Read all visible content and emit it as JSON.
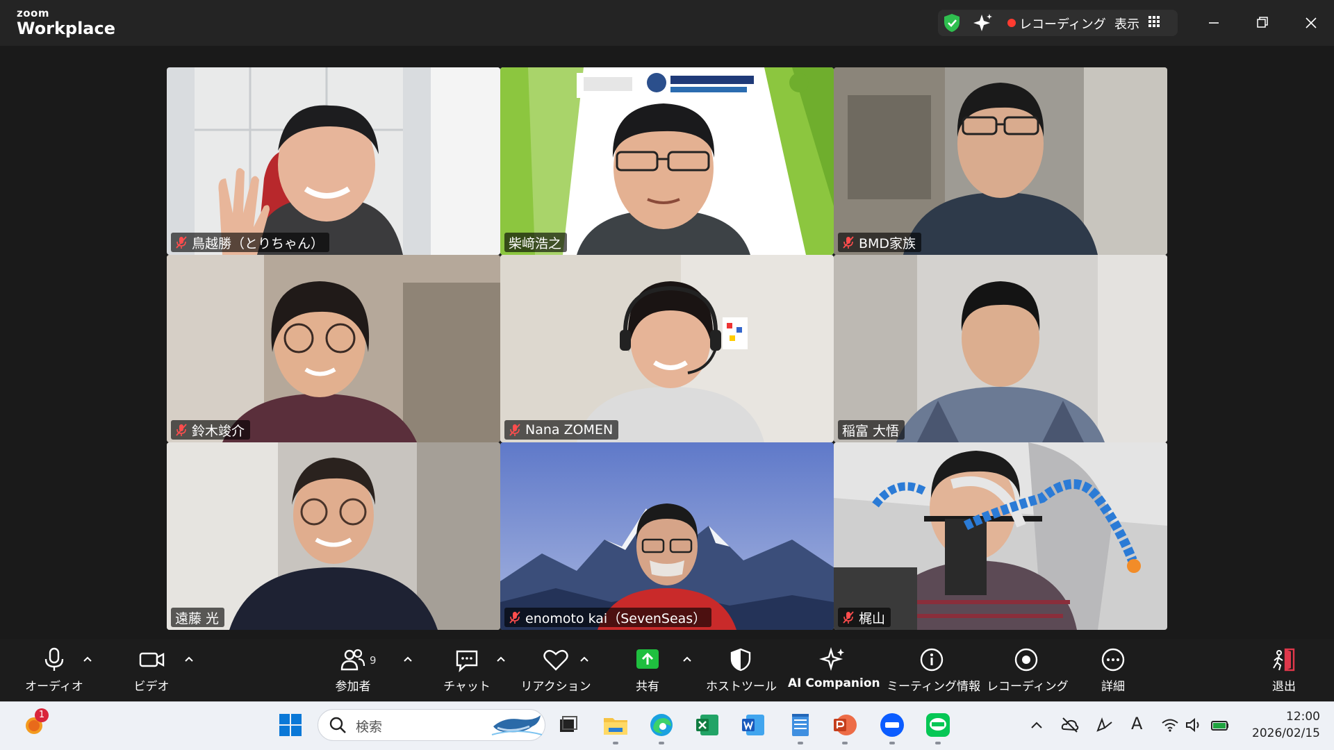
{
  "app": {
    "brand_small": "zoom",
    "brand_large": "Workplace"
  },
  "titlebar": {
    "recording_label": "レコーディング",
    "view_label": "表示"
  },
  "colors": {
    "active_speaker": "#3ddc84",
    "recording_dot": "#ff3b30",
    "mute": "#ff4d4d",
    "share_green": "#1fbf3f"
  },
  "participants": [
    {
      "name": "鳥越勝（とりちゃん）",
      "muted": true
    },
    {
      "name": "柴﨑浩之",
      "muted": false,
      "active": true
    },
    {
      "name": "BMD家族",
      "muted": true
    },
    {
      "name": "鈴木竣介",
      "muted": true
    },
    {
      "name": "Nana ZOMEN",
      "muted": true
    },
    {
      "name": "稲富 大悟",
      "muted": false
    },
    {
      "name": "遠藤 光",
      "muted": false
    },
    {
      "name": "enomoto kai（SevenSeas）",
      "muted": true
    },
    {
      "name": "梶山",
      "muted": true
    }
  ],
  "toolbar": {
    "audio": "オーディオ",
    "video": "ビデオ",
    "participants": "参加者",
    "participants_count": "9",
    "chat": "チャット",
    "reactions": "リアクション",
    "share": "共有",
    "host_tools": "ホストツール",
    "ai_companion": "AI Companion",
    "meeting_info": "ミーティング情報",
    "recording": "レコーディング",
    "more": "詳細",
    "leave": "退出"
  },
  "taskbar": {
    "search_placeholder": "検索",
    "notification_count": "1",
    "time": "12:00",
    "date": "2026/02/15",
    "ime_label": "A"
  }
}
